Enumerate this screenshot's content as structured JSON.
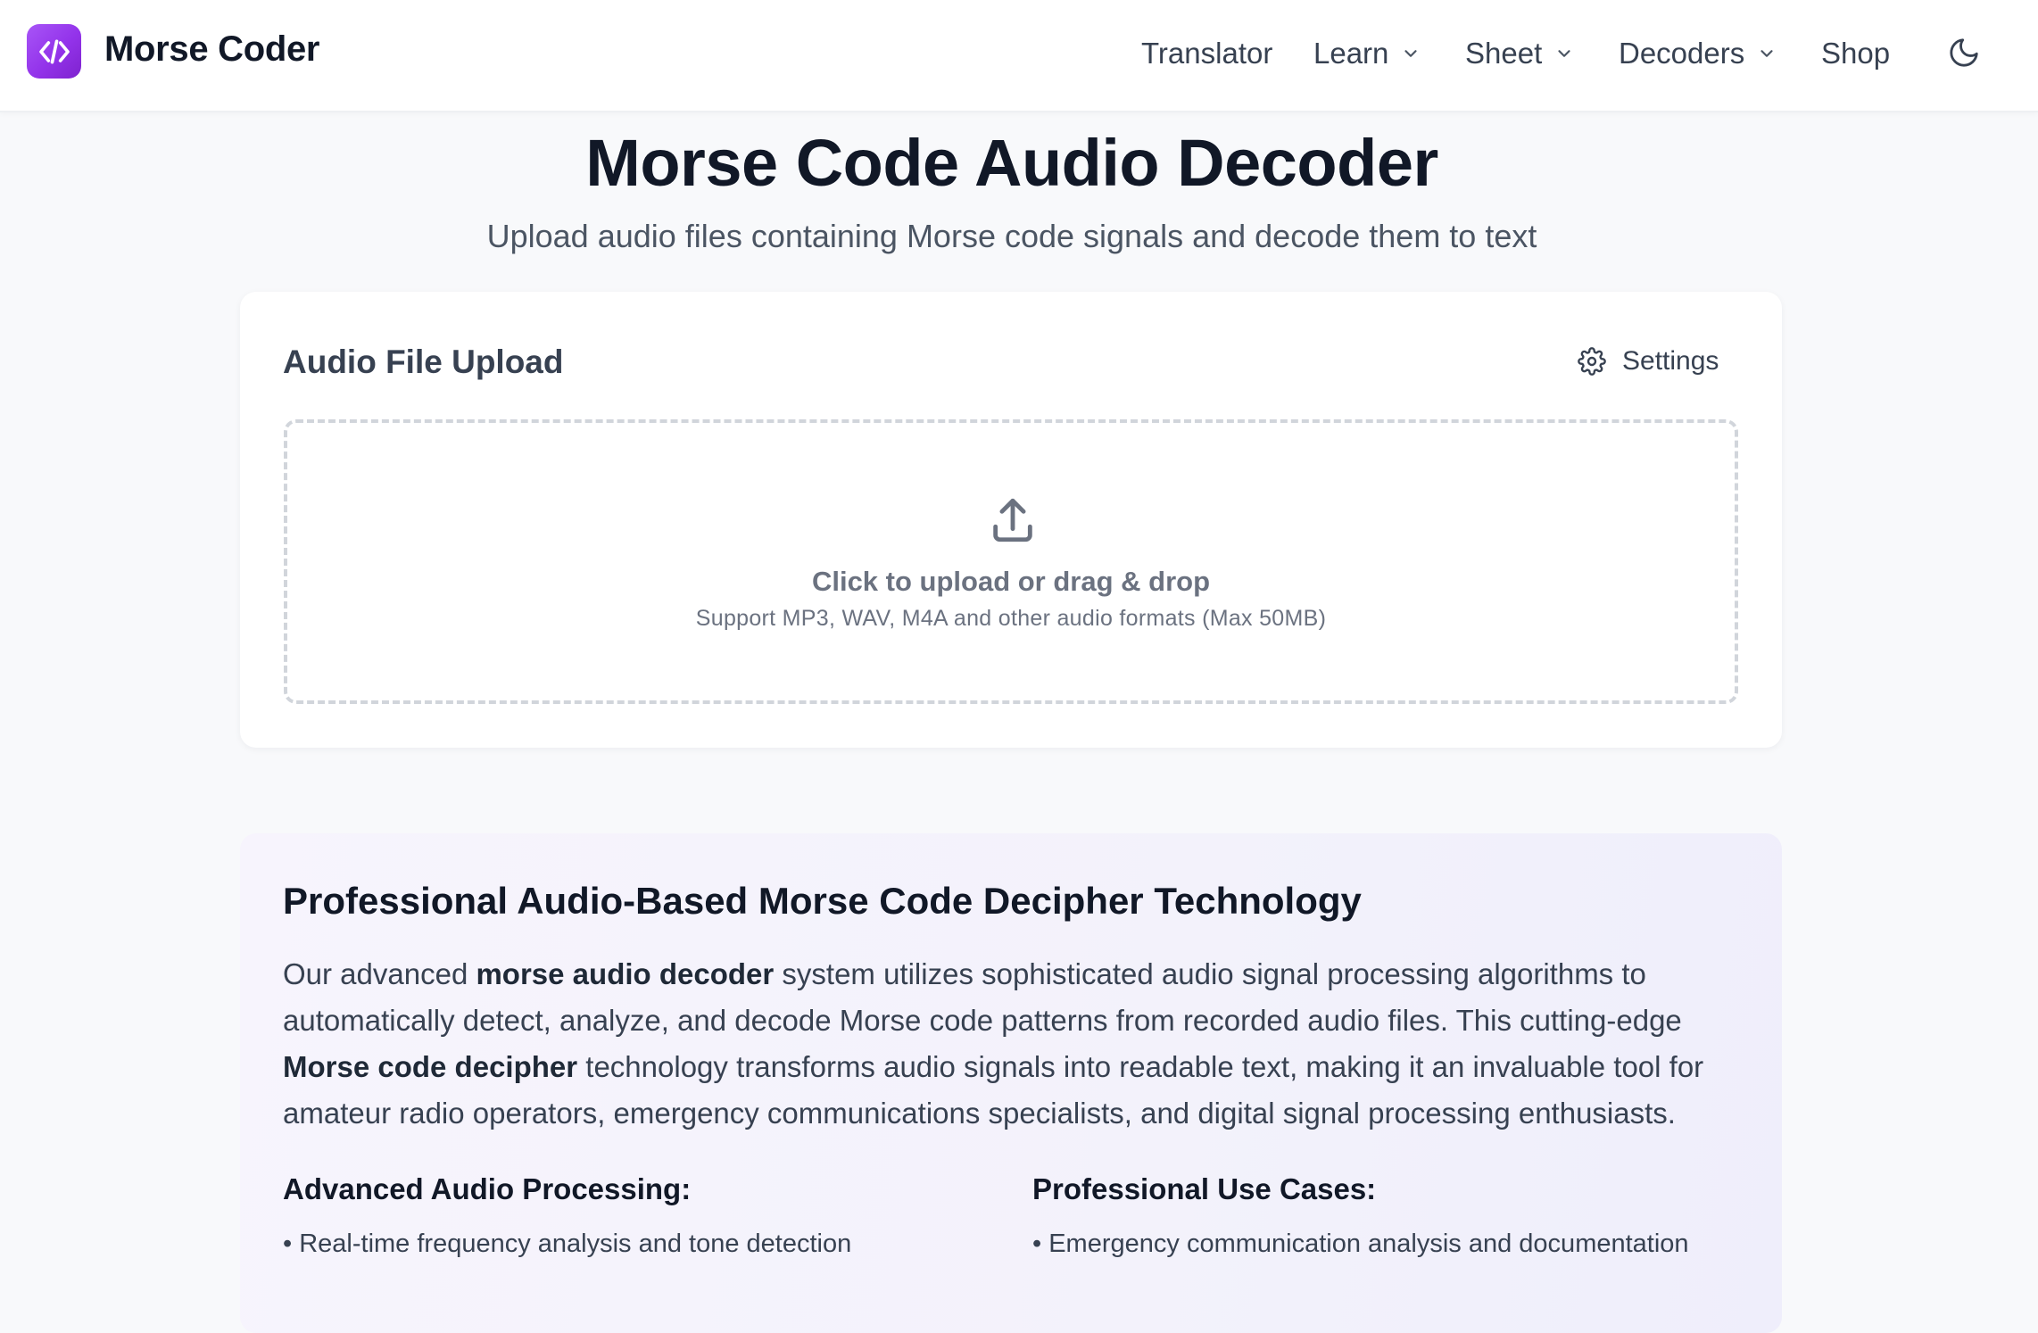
{
  "header": {
    "brand": "Morse Coder",
    "logo_icon": "code-brackets-icon",
    "nav": [
      {
        "label": "Translator",
        "has_dropdown": false
      },
      {
        "label": "Learn",
        "has_dropdown": true
      },
      {
        "label": "Sheet",
        "has_dropdown": true
      },
      {
        "label": "Decoders",
        "has_dropdown": true
      },
      {
        "label": "Shop",
        "has_dropdown": false
      }
    ],
    "theme_icon": "moon-icon"
  },
  "page": {
    "title": "Morse Code Audio Decoder",
    "subtitle": "Upload audio files containing Morse code signals and decode them to text"
  },
  "upload_card": {
    "title": "Audio File Upload",
    "settings_label": "Settings",
    "dropzone": {
      "primary": "Click to upload or drag & drop",
      "secondary": "Support MP3, WAV, M4A and other audio formats (Max 50MB)"
    }
  },
  "info": {
    "title": "Professional Audio-Based Morse Code Decipher Technology",
    "para": {
      "t1": "Our advanced ",
      "b1": "morse audio decoder",
      "t2": " system utilizes sophisticated audio signal processing algorithms to automatically detect, analyze, and decode Morse code patterns from recorded audio files. This cutting-edge ",
      "b2": "Morse code decipher",
      "t3": " technology transforms audio signals into readable text, making it an invaluable tool for amateur radio operators, emergency communications specialists, and digital signal processing enthusiasts."
    },
    "col_left": {
      "heading": "Advanced Audio Processing:",
      "items": [
        "Real-time frequency analysis and tone detection"
      ]
    },
    "col_right": {
      "heading": "Professional Use Cases:",
      "items": [
        "Emergency communication analysis and documentation"
      ]
    }
  },
  "colors": {
    "brand_gradient_start": "#a855f7",
    "brand_gradient_end": "#7e22ce",
    "text_primary": "#111827",
    "text_muted": "#6b7280"
  }
}
